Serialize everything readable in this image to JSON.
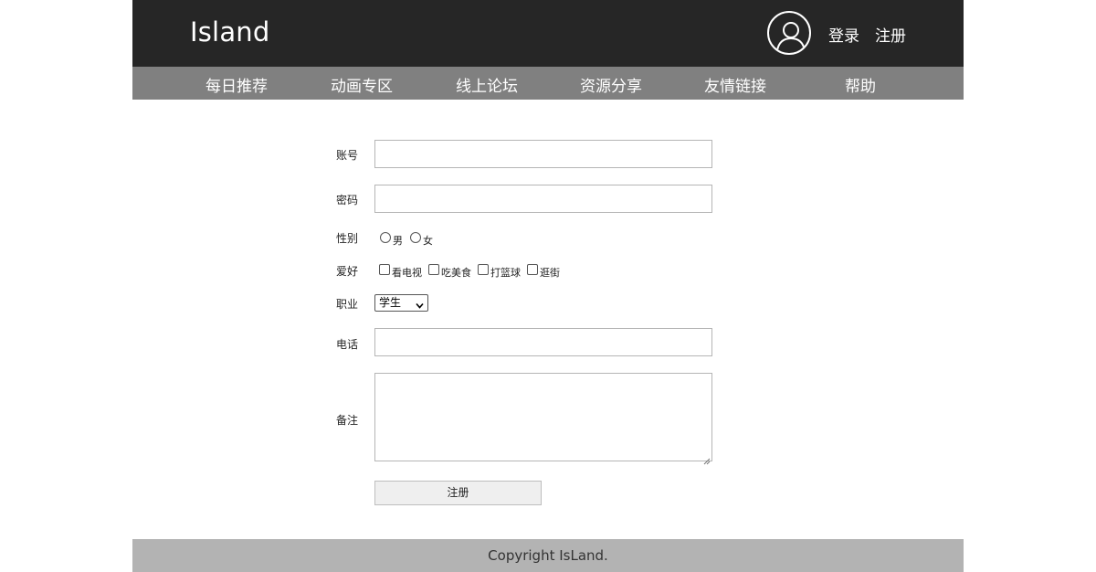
{
  "header": {
    "logo": "Island",
    "login_label": "登录",
    "register_label": "注册"
  },
  "nav": {
    "items": [
      {
        "label": "每日推荐"
      },
      {
        "label": "动画专区"
      },
      {
        "label": "线上论坛"
      },
      {
        "label": "资源分享"
      },
      {
        "label": "友情链接"
      },
      {
        "label": "帮助"
      }
    ]
  },
  "form": {
    "account_label": "账号",
    "account_value": "",
    "password_label": "密码",
    "password_value": "",
    "gender_label": "性别",
    "gender_options": [
      "男",
      "女"
    ],
    "hobby_label": "爱好",
    "hobby_options": [
      "看电视",
      "吃美食",
      "打篮球",
      "逛街"
    ],
    "job_label": "职业",
    "job_selected": "学生",
    "phone_label": "电话",
    "phone_value": "",
    "note_label": "备注",
    "note_value": "",
    "submit_label": "注册"
  },
  "footer": {
    "copyright": "Copyright IsLand."
  },
  "colors": {
    "header_bg": "#262626",
    "nav_bg": "#808080",
    "footer_bg": "#b3b3b3",
    "button_bg": "#efefef"
  },
  "icons": {
    "avatar": "user-avatar-icon",
    "select_arrow": "chevron-down-icon"
  }
}
